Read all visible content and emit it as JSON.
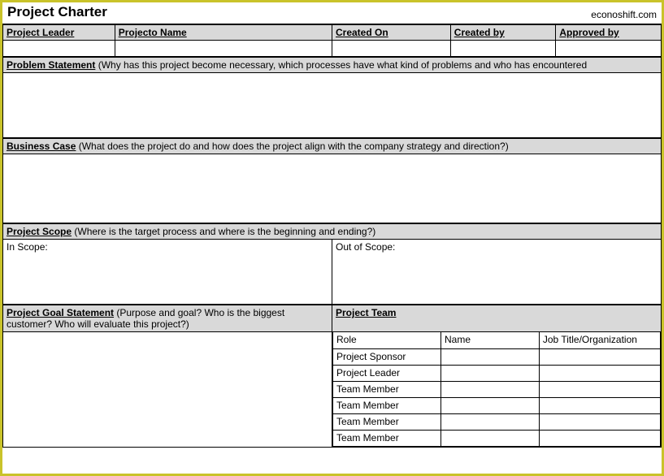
{
  "header": {
    "title": "Project Charter",
    "brand": "econoshift.com"
  },
  "meta": {
    "leader_label": "Project Leader",
    "name_label": "Projecto Name",
    "created_on_label": "Created On",
    "created_by_label": "Created by",
    "approved_by_label": "Approved by",
    "leader": "",
    "name": "",
    "created_on": "",
    "created_by": "",
    "approved_by": ""
  },
  "problem": {
    "label": "Problem Statement",
    "desc": " (Why has this project become necessary, which processes have what kind of problems and who has encountered",
    "value": ""
  },
  "business_case": {
    "label": "Business Case",
    "desc": " (What does the project do and how does the project align with the company strategy and direction?)",
    "value": ""
  },
  "scope": {
    "label": "Project Scope",
    "desc": " (Where is the target process and where is the beginning and ending?)",
    "in_label": "In Scope:",
    "out_label": "Out of Scope:",
    "in_value": "",
    "out_value": ""
  },
  "goal": {
    "label": "Project Goal Statement",
    "desc": " (Purpose and goal?  Who is the biggest customer?  Who will evaluate this project?)",
    "value": ""
  },
  "team": {
    "label": "Project Team",
    "cols": {
      "role": "Role",
      "name": "Name",
      "org": "Job Title/Organization"
    },
    "rows": [
      {
        "role": "Project Sponsor",
        "name": "",
        "org": ""
      },
      {
        "role": "Project Leader",
        "name": "",
        "org": ""
      },
      {
        "role": "Team Member",
        "name": "",
        "org": ""
      },
      {
        "role": "Team Member",
        "name": "",
        "org": ""
      },
      {
        "role": "Team Member",
        "name": "",
        "org": ""
      },
      {
        "role": "Team Member",
        "name": "",
        "org": ""
      }
    ]
  }
}
